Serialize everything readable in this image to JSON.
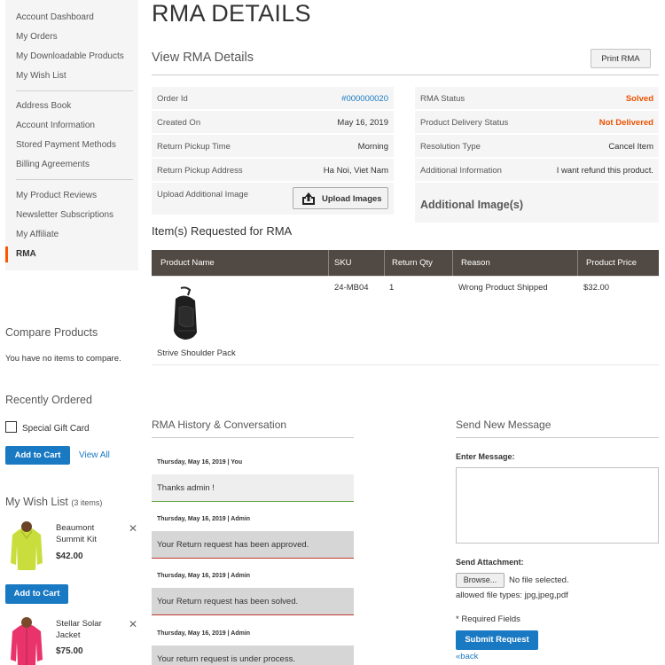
{
  "sidebar": {
    "nav_items": [
      {
        "label": "Account Dashboard"
      },
      {
        "label": "My Orders"
      },
      {
        "label": "My Downloadable Products"
      },
      {
        "label": "My Wish List"
      },
      {
        "label": "Address Book"
      },
      {
        "label": "Account Information"
      },
      {
        "label": "Stored Payment Methods"
      },
      {
        "label": "Billing Agreements"
      },
      {
        "label": "My Product Reviews"
      },
      {
        "label": "Newsletter Subscriptions"
      },
      {
        "label": "My Affiliate"
      },
      {
        "label": "RMA"
      }
    ],
    "active_item": "RMA",
    "compare": {
      "title": "Compare Products",
      "empty_text": "You have no items to compare."
    },
    "recently_ordered": {
      "title": "Recently Ordered",
      "item_label": "Special Gift Card",
      "add_to_cart_label": "Add to Cart",
      "view_all_label": "View All"
    },
    "wishlist": {
      "title": "My Wish List",
      "count_text": "(3 items)",
      "items": [
        {
          "name": "Beaumont Summit Kit",
          "price": "$42.00",
          "add_label": "Add to Cart"
        },
        {
          "name": "Stellar Solar Jacket",
          "price": "$75.00"
        }
      ]
    }
  },
  "main": {
    "page_title": "RMA DETAILS",
    "view_title": "View RMA Details",
    "print_label": "Print RMA",
    "left_details": [
      {
        "label": "Order Id",
        "value": "#000000020"
      },
      {
        "label": "Created On",
        "value": "May 16, 2019"
      },
      {
        "label": "Return Pickup Time",
        "value": "Morning"
      },
      {
        "label": "Return Pickup Address",
        "value": "Ha Noi, Viet Nam"
      },
      {
        "label": "Upload Additional Image",
        "value": ""
      }
    ],
    "upload_label": "Upload Images",
    "right_details": [
      {
        "label": "RMA Status",
        "value": "Solved"
      },
      {
        "label": "Product Delivery Status",
        "value": "Not Delivered"
      },
      {
        "label": "Resolution Type",
        "value": "Cancel Item"
      },
      {
        "label": "Additional Information",
        "value": "I want refund this product."
      }
    ],
    "additional_images_title": "Additional Image(s)",
    "items_title": "Item(s) Requested for RMA",
    "table": {
      "headers": [
        "Product Name",
        "SKU",
        "Return Qty",
        "Reason",
        "Product Price"
      ],
      "rows": [
        {
          "product_name": "Strive Shoulder Pack",
          "sku": "24-MB04",
          "qty": "1",
          "reason": "Wrong Product Shipped",
          "price": "$32.00"
        }
      ]
    },
    "history": {
      "title": "RMA History & Conversation",
      "entries": [
        {
          "meta": "Thursday, May 16, 2019 | You",
          "message": "Thanks admin !"
        },
        {
          "meta": "Thursday, May 16, 2019 | Admin",
          "message": "Your Return request has been approved."
        },
        {
          "meta": "Thursday, May 16, 2019 | Admin",
          "message": "Your Return request has been solved."
        },
        {
          "meta": "Thursday, May 16, 2019 | Admin",
          "message": "Your return request is under process."
        }
      ]
    },
    "message": {
      "title": "Send New Message",
      "enter_label": "Enter Message:",
      "attachment_label": "Send Attachment:",
      "browse_label": "Browse...",
      "no_file_text": "No file selected.",
      "allowed_types": "allowed file types: jpg,jpeg,pdf",
      "required_text": "* Required Fields",
      "submit_label": "Submit Request",
      "back_label": "«back"
    }
  },
  "colors": {
    "accent_blue": "#1979c3",
    "status_orange": "#eb5202",
    "table_header": "#514943",
    "nav_active": "#ff5501"
  }
}
